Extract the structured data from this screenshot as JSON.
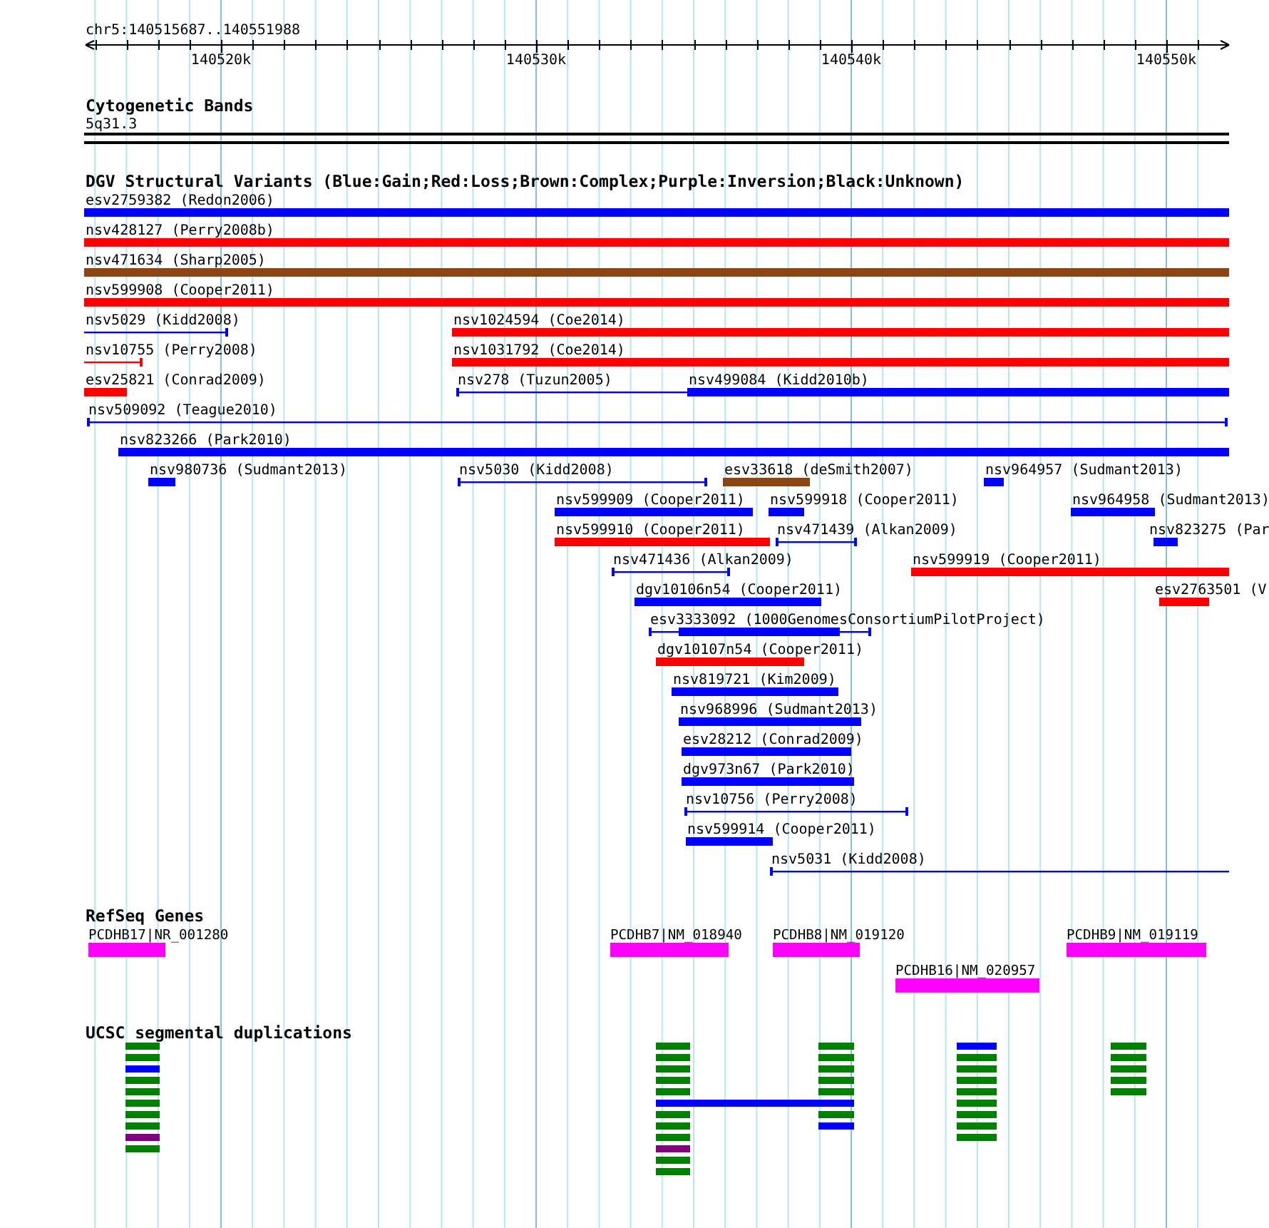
{
  "ruler": {
    "region": "chr5:140515687..140551988",
    "ticks": [
      "140520k",
      "140530k",
      "140540k",
      "140550k"
    ]
  },
  "cytoband": {
    "title": "Cytogenetic Bands",
    "band": "5q31.3"
  },
  "variants": {
    "title": "DGV Structural Variants (Blue:Gain;Red:Loss;Brown:Complex;Purple:Inversion;Black:Unknown)",
    "items": [
      {
        "label": "esv2759382 (Redon2006)",
        "color": "#0000ff",
        "kind": "bar"
      },
      {
        "label": "nsv428127 (Perry2008b)",
        "color": "#ff0000",
        "kind": "bar"
      },
      {
        "label": "nsv471634 (Sharp2005)",
        "color": "#8b4513",
        "kind": "bar"
      },
      {
        "label": "nsv599908 (Cooper2011)",
        "color": "#ff0000",
        "kind": "bar"
      },
      {
        "label": "nsv5029 (Kidd2008)",
        "color": "#0000ff",
        "kind": "line"
      },
      {
        "label": "nsv1024594 (Coe2014)",
        "color": "#ff0000",
        "kind": "bar"
      },
      {
        "label": "nsv10755 (Perry2008)",
        "color": "#ff0000",
        "kind": "line"
      },
      {
        "label": "nsv1031792 (Coe2014)",
        "color": "#ff0000",
        "kind": "bar"
      },
      {
        "label": "esv25821 (Conrad2009)",
        "color": "#ff0000",
        "kind": "bar"
      },
      {
        "label": "nsv278 (Tuzun2005)",
        "color": "#0000ff",
        "kind": "line"
      },
      {
        "label": "nsv499084 (Kidd2010b)",
        "color": "#0000ff",
        "kind": "bar"
      },
      {
        "label": "nsv509092 (Teague2010)",
        "color": "#0000ff",
        "kind": "line"
      },
      {
        "label": "nsv823266 (Park2010)",
        "color": "#0000ff",
        "kind": "bar"
      },
      {
        "label": "nsv980736 (Sudmant2013)",
        "color": "#0000ff",
        "kind": "bar"
      },
      {
        "label": "nsv5030 (Kidd2008)",
        "color": "#0000ff",
        "kind": "line"
      },
      {
        "label": "esv33618 (deSmith2007)",
        "color": "#8b4513",
        "kind": "bar"
      },
      {
        "label": "nsv964957 (Sudmant2013)",
        "color": "#0000ff",
        "kind": "bar"
      },
      {
        "label": "nsv599909 (Cooper2011)",
        "color": "#0000ff",
        "kind": "bar"
      },
      {
        "label": "nsv599918 (Cooper2011)",
        "color": "#0000ff",
        "kind": "bar"
      },
      {
        "label": "nsv964958 (Sudmant2013)",
        "color": "#0000ff",
        "kind": "bar"
      },
      {
        "label": "nsv599910 (Cooper2011)",
        "color": "#ff0000",
        "kind": "bar"
      },
      {
        "label": "nsv471439 (Alkan2009)",
        "color": "#0000ff",
        "kind": "line"
      },
      {
        "label": "nsv823275 (Par",
        "color": "#0000ff",
        "kind": "bar"
      },
      {
        "label": "nsv471436 (Alkan2009)",
        "color": "#0000ff",
        "kind": "line"
      },
      {
        "label": "nsv599919 (Cooper2011)",
        "color": "#ff0000",
        "kind": "bar"
      },
      {
        "label": "dgv10106n54 (Cooper2011)",
        "color": "#0000ff",
        "kind": "bar"
      },
      {
        "label": "esv2763501 (V",
        "color": "#ff0000",
        "kind": "bar"
      },
      {
        "label": "esv3333092 (1000GenomesConsortiumPilotProject)",
        "color": "#0000ff",
        "kind": "line_bar"
      },
      {
        "label": "dgv10107n54 (Cooper2011)",
        "color": "#ff0000",
        "kind": "bar"
      },
      {
        "label": "nsv819721 (Kim2009)",
        "color": "#0000ff",
        "kind": "bar"
      },
      {
        "label": "nsv968996 (Sudmant2013)",
        "color": "#0000ff",
        "kind": "bar"
      },
      {
        "label": "esv28212 (Conrad2009)",
        "color": "#0000ff",
        "kind": "bar"
      },
      {
        "label": "dgv973n67 (Park2010)",
        "color": "#0000ff",
        "kind": "bar"
      },
      {
        "label": "nsv10756 (Perry2008)",
        "color": "#0000ff",
        "kind": "line"
      },
      {
        "label": "nsv599914 (Cooper2011)",
        "color": "#0000ff",
        "kind": "bar"
      },
      {
        "label": "nsv5031 (Kidd2008)",
        "color": "#0000ff",
        "kind": "line"
      }
    ]
  },
  "genes": {
    "title": "RefSeq Genes",
    "items": [
      {
        "label": "PCDHB17|NR_001280"
      },
      {
        "label": "PCDHB7|NM_018940"
      },
      {
        "label": "PCDHB8|NM_019120"
      },
      {
        "label": "PCDHB9|NM_019119"
      },
      {
        "label": "PCDHB16|NM_020957"
      }
    ]
  },
  "segdups": {
    "title": "UCSC segmental duplications",
    "columns": [
      [
        {
          "color": "#008000",
          "kind": "block"
        },
        {
          "color": "#008000",
          "kind": "block"
        },
        {
          "color": "#0000ff",
          "kind": "block"
        },
        {
          "color": "#008000",
          "kind": "block"
        },
        {
          "color": "#008000",
          "kind": "block"
        },
        {
          "color": "#008000",
          "kind": "block"
        },
        {
          "color": "#008000",
          "kind": "block"
        },
        {
          "color": "#008000",
          "kind": "block"
        },
        {
          "color": "#800080",
          "kind": "block"
        },
        {
          "color": "#008000",
          "kind": "block"
        }
      ],
      [
        {
          "color": "#008000",
          "kind": "block"
        },
        {
          "color": "#008000",
          "kind": "block"
        },
        {
          "color": "#008000",
          "kind": "block"
        },
        {
          "color": "#008000",
          "kind": "block"
        },
        {
          "color": "#008000",
          "kind": "block"
        },
        {
          "color": "#0000ff",
          "kind": "link"
        },
        {
          "color": "#008000",
          "kind": "block"
        },
        {
          "color": "#008000",
          "kind": "block"
        },
        {
          "color": "#008000",
          "kind": "block"
        },
        {
          "color": "#800080",
          "kind": "block"
        },
        {
          "color": "#008000",
          "kind": "block"
        },
        {
          "color": "#008000",
          "kind": "block"
        }
      ],
      [
        {
          "color": "#008000",
          "kind": "block"
        },
        {
          "color": "#008000",
          "kind": "block"
        },
        {
          "color": "#008000",
          "kind": "block"
        },
        {
          "color": "#008000",
          "kind": "block"
        },
        {
          "color": "#008000",
          "kind": "block"
        },
        {
          "color": "#008000",
          "kind": "block"
        },
        {
          "color": "#0000ff",
          "kind": "block"
        }
      ],
      [
        {
          "color": "#0000ff",
          "kind": "block"
        },
        {
          "color": "#008000",
          "kind": "block"
        },
        {
          "color": "#008000",
          "kind": "block"
        },
        {
          "color": "#008000",
          "kind": "block"
        },
        {
          "color": "#008000",
          "kind": "block"
        },
        {
          "color": "#008000",
          "kind": "block"
        },
        {
          "color": "#008000",
          "kind": "block"
        },
        {
          "color": "#008000",
          "kind": "block"
        },
        {
          "color": "#008000",
          "kind": "block"
        }
      ],
      [
        {
          "color": "#008000",
          "kind": "block"
        },
        {
          "color": "#008000",
          "kind": "block"
        },
        {
          "color": "#008000",
          "kind": "block"
        },
        {
          "color": "#008000",
          "kind": "block"
        },
        {
          "color": "#008000",
          "kind": "block"
        }
      ]
    ]
  }
}
